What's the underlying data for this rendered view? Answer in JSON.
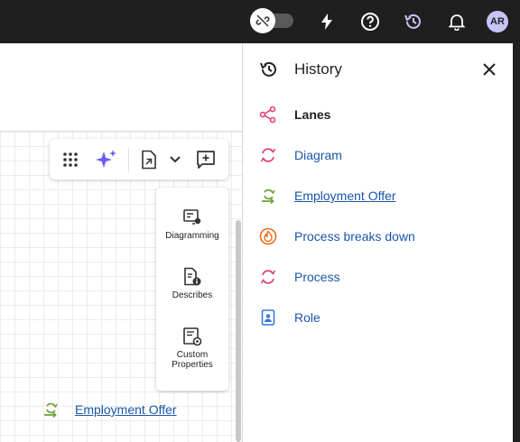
{
  "topbar": {
    "avatar_initials": "AR",
    "icons": [
      "link-off-icon",
      "lightning-icon",
      "help-icon",
      "history-icon",
      "bell-icon"
    ],
    "accent_color": "#c9c4f7"
  },
  "toolbar": {
    "icons": [
      "grid-dots-icon",
      "ai-sparkle-icon",
      "document-export-icon",
      "chevron-down-icon",
      "add-comment-icon"
    ]
  },
  "side_panel": {
    "items": [
      {
        "label": "Diagramming"
      },
      {
        "label": "Describes"
      },
      {
        "label": "Custom Properties"
      }
    ]
  },
  "canvas": {
    "link_label": "Employment Offer"
  },
  "history": {
    "title": "History",
    "items": [
      {
        "label": "Lanes",
        "icon": "lanes-icon",
        "color": "#e0407b"
      },
      {
        "label": "Diagram",
        "icon": "cycle-icon",
        "color": "#e0407b"
      },
      {
        "label": "Employment Offer",
        "icon": "recycle-arrow-icon",
        "color": "#6fa43a"
      },
      {
        "label": "Process breaks down",
        "icon": "fire-icon",
        "color": "#f06a1a"
      },
      {
        "label": "Process",
        "icon": "cycle-icon",
        "color": "#e0407b"
      },
      {
        "label": "Role",
        "icon": "person-card-icon",
        "color": "#3a78d6"
      }
    ]
  }
}
